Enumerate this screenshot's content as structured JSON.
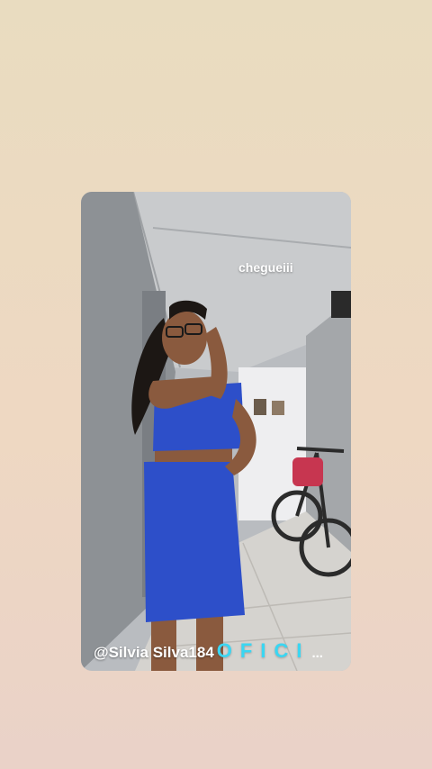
{
  "story": {
    "caption": "chegueiii",
    "watermark_handle": "@Silvia Silva184",
    "watermark_brand": "OFICI",
    "watermark_overflow": "..."
  },
  "colors": {
    "brand_accent": "#3ad6f2",
    "dress_blue": "#2d4fc9"
  }
}
